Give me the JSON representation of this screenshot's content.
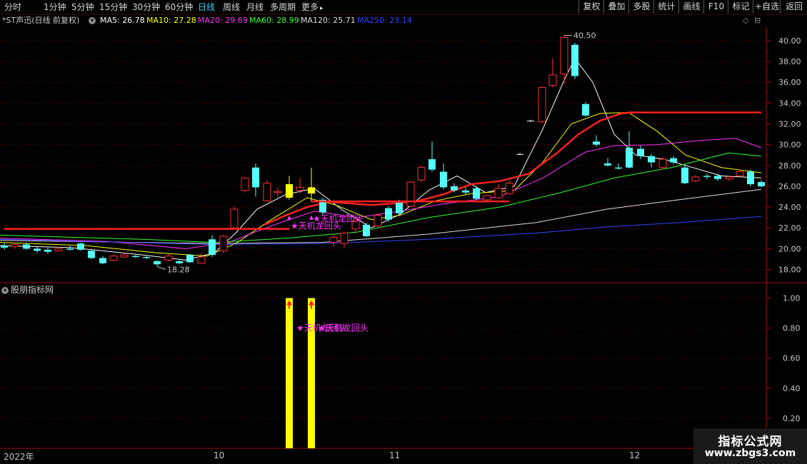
{
  "toolbar": {
    "periods": [
      "分时",
      "1分钟",
      "5分钟",
      "15分钟",
      "30分钟",
      "60分钟",
      "日线",
      "周线",
      "月线",
      "多周期",
      "更多"
    ],
    "active_period": "日线",
    "more_caret": "▸",
    "right_buttons": [
      "复权",
      "叠加",
      "多股",
      "统计",
      "画线",
      "F10",
      "标记",
      "+自选",
      "返回"
    ]
  },
  "header": {
    "stock_title": "*ST声迅(日线 前复权)",
    "ma": [
      {
        "label": "MA5: 26.78",
        "color": "#ffffff"
      },
      {
        "label": "MA10: 27.28",
        "color": "#ffff00"
      },
      {
        "label": "MA20: 29.69",
        "color": "#ff33ff"
      },
      {
        "label": "MA60: 28.99",
        "color": "#33ff33"
      },
      {
        "label": "MA120: 25.71",
        "color": "#dddddd"
      },
      {
        "label": "MA250: 23.14",
        "color": "#3344ff"
      }
    ],
    "corner_icons": [
      "◇",
      "⊟"
    ]
  },
  "main_chart": {
    "y_ticks": [
      "40.00",
      "38.00",
      "36.00",
      "34.00",
      "32.00",
      "30.00",
      "28.00",
      "26.00",
      "24.00",
      "22.00",
      "20.00",
      "18.00"
    ],
    "y_range": [
      16.8,
      41.3
    ],
    "high_label": "40.50",
    "low_label": "18.28",
    "signal_labels": [
      "★天机龙回头",
      "★天机龙回头"
    ],
    "colors": {
      "up": "#ff3030",
      "down": "#54ffff",
      "neutral": "#ffffff",
      "signal": "#ffff00",
      "level": "#ff2020",
      "label": "#ff33ff"
    }
  },
  "indicator_panel": {
    "title": "股朋指标网",
    "y_ticks": [
      "1.00",
      "0.80",
      "0.60",
      "0.40",
      "0.20"
    ],
    "y_range": [
      0,
      1.05
    ],
    "signal_text": "★天机龙回头",
    "bar_value": 1.0
  },
  "date_axis": {
    "labels": [
      "2022年",
      "10",
      "11",
      "12"
    ]
  },
  "watermark": {
    "title": "指标公式网",
    "url": "www.zbgs3.com"
  }
}
